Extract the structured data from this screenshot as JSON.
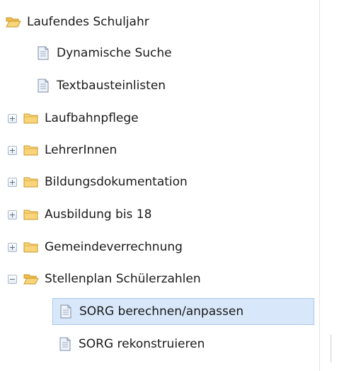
{
  "tree": {
    "root": {
      "label": "Laufendes Schuljahr"
    },
    "items": [
      {
        "label": "Dynamische Suche",
        "icon": "document-icon"
      },
      {
        "label": "Textbausteinlisten",
        "icon": "document-icon"
      },
      {
        "label": "Laufbahnpflege",
        "icon": "folder-icon",
        "expanded": false
      },
      {
        "label": "LehrerInnen",
        "icon": "folder-icon",
        "expanded": false
      },
      {
        "label": "Bildungsdokumentation",
        "icon": "folder-icon",
        "expanded": false
      },
      {
        "label": "Ausbildung bis 18",
        "icon": "folder-icon",
        "expanded": false
      },
      {
        "label": "Gemeindeverrechnung",
        "icon": "folder-icon",
        "expanded": false
      },
      {
        "label": "Stellenplan Schülerzahlen",
        "icon": "folder-open-icon",
        "expanded": true
      },
      {
        "label": "SORG berechnen/anpassen",
        "icon": "document-icon",
        "selected": true
      },
      {
        "label": "SORG rekonstruieren",
        "icon": "document-icon"
      }
    ]
  },
  "colors": {
    "folder": "#f5c85a",
    "folder_border": "#c9972c",
    "document": "#eef3fa",
    "document_border": "#7d8ea6",
    "selection": "#d8e8fa"
  }
}
